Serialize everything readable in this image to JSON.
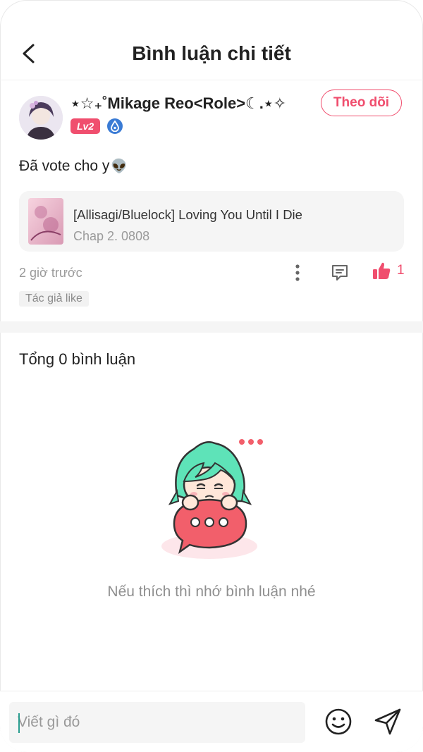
{
  "header": {
    "title": "Bình luận chi tiết"
  },
  "comment": {
    "username": "⋆☆₊˚Mikage Reo<Role>☾.⋆✧",
    "level": "Lv2",
    "follow_label": "Theo dõi",
    "text": "Đã vote cho y",
    "text_emoji": "👽",
    "story": {
      "title": "[Allisagi/Bluelock] Loving You Until I Die",
      "chapter": "Chap 2. 0808"
    },
    "time": "2 giờ trước",
    "like_count": "1",
    "author_tag": "Tác giả like"
  },
  "comments_section": {
    "total": "Tổng 0 bình luận",
    "empty_message": "Nếu thích thì nhớ bình luận nhé"
  },
  "composer": {
    "placeholder": "Viết gì đó"
  },
  "colors": {
    "accent": "#f04e6e",
    "mascot_hair": "#5ee3b8",
    "bubble": "#f25f6b"
  },
  "icons": [
    "back-arrow-icon",
    "drop-badge-icon",
    "more-dots-icon",
    "reply-icon",
    "thumbs-up-icon",
    "emoji-icon",
    "send-icon"
  ]
}
